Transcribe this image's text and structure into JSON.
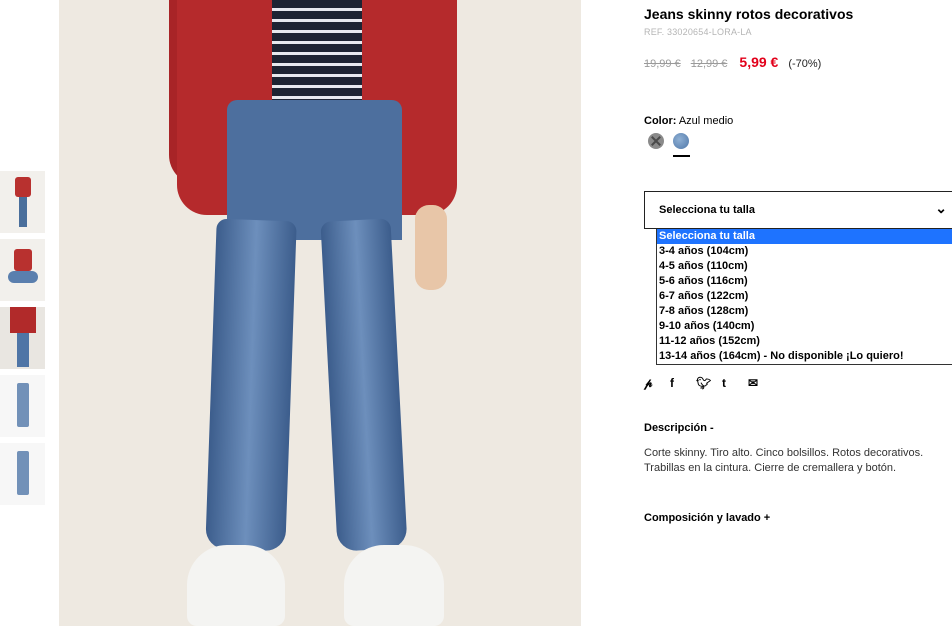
{
  "product": {
    "title": "Jeans skinny rotos decorativos",
    "ref": "REF. 33020654-LORA-LA",
    "prices": {
      "original": "19,99 €",
      "previous": "12,99 €",
      "sale": "5,99 €",
      "discount": "(-70%)"
    },
    "color": {
      "label": "Color:",
      "value": "Azul medio",
      "swatches": [
        {
          "icon": "unavailable-color-swatch",
          "color": "#8a8a8a"
        },
        {
          "icon": "blue-denim-swatch",
          "color": "#5f84b3",
          "selected": true
        }
      ]
    },
    "size": {
      "select_label": "Selecciona tu talla",
      "options": [
        "Selecciona tu talla",
        "3-4 años (104cm)",
        "4-5 años (110cm)",
        "5-6 años (116cm)",
        "6-7 años (122cm)",
        "7-8 años (128cm)",
        "9-10 años (140cm)",
        "11-12 años (152cm)",
        "13-14 años (164cm) - No disponible ¡Lo quiero!"
      ],
      "highlighted_index": 0
    },
    "share": [
      "pinterest-icon",
      "facebook-icon",
      "twitter-icon",
      "tumblr-icon",
      "email-icon"
    ],
    "description": {
      "heading": "Descripción -",
      "text": "Corte skinny. Tiro alto. Cinco bolsillos. Rotos decorativos. Trabillas en la cintura. Cierre de cremallera y botón."
    },
    "composition": {
      "heading": "Composición y lavado +"
    }
  },
  "colors": {
    "sale_price": "#e2001a",
    "dropdown_highlight": "#1e73ff"
  }
}
